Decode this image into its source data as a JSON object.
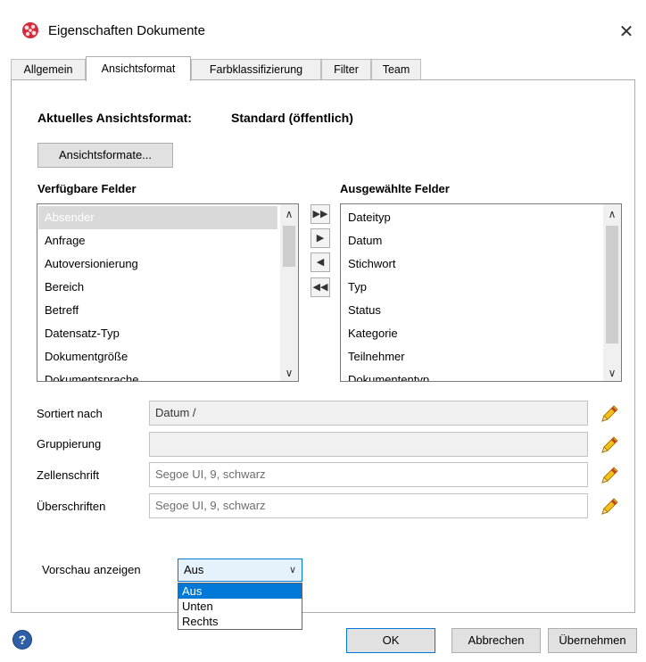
{
  "window": {
    "title": "Eigenschaften Dokumente",
    "close_label": "✕"
  },
  "tabs": [
    {
      "label": "Allgemein"
    },
    {
      "label": "Ansichtsformat"
    },
    {
      "label": "Farbklassifizierung"
    },
    {
      "label": "Filter"
    },
    {
      "label": "Team"
    }
  ],
  "current_format": {
    "label": "Aktuelles Ansichtsformat:",
    "value": "Standard (öffentlich)",
    "button_label": "Ansichtsformate..."
  },
  "available_fields": {
    "heading": "Verfügbare Felder",
    "items": [
      "Absender",
      "Anfrage",
      "Autoversionierung",
      "Bereich",
      "Betreff",
      "Datensatz-Typ",
      "Dokumentgröße",
      "Dokumentsprache"
    ],
    "selected_index": 0
  },
  "selected_fields": {
    "heading": "Ausgewählte Felder",
    "items": [
      "Dateityp",
      "Datum",
      "Stichwort",
      "Typ",
      "Status",
      "Kategorie",
      "Teilnehmer",
      "Dokumententyp"
    ]
  },
  "move_buttons": {
    "add_all": "▶▶",
    "add": "▶",
    "remove": "◀",
    "remove_all": "◀◀"
  },
  "settings": {
    "sort": {
      "label": "Sortiert nach",
      "value": "Datum  /"
    },
    "group": {
      "label": "Gruppierung",
      "value": ""
    },
    "cell_font": {
      "label": "Zellenschrift",
      "value": "Segoe UI, 9, schwarz"
    },
    "headings": {
      "label": "Überschriften",
      "value": "Segoe UI, 9, schwarz"
    }
  },
  "preview": {
    "label": "Vorschau anzeigen",
    "value": "Aus",
    "options": [
      "Aus",
      "Unten",
      "Rechts"
    ],
    "selected_index": 0
  },
  "footer": {
    "help": "?",
    "ok": "OK",
    "cancel": "Abbrechen",
    "apply": "Übernehmen"
  },
  "colors": {
    "accent": "#0078d7",
    "selection_gray": "#d9d9d9"
  }
}
